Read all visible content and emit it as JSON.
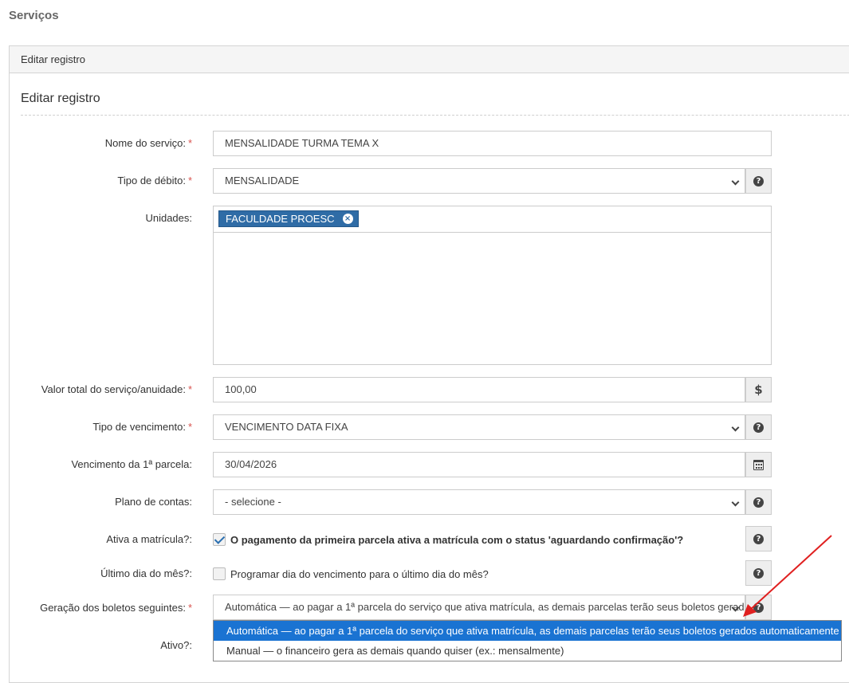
{
  "page": {
    "title": "Serviços"
  },
  "panel": {
    "heading": "Editar registro",
    "section_title": "Editar registro"
  },
  "form": {
    "nome": {
      "label": "Nome do serviço:",
      "value": "MENSALIDADE TURMA TEMA X"
    },
    "tipo_debito": {
      "label": "Tipo de débito:",
      "value": "MENSALIDADE"
    },
    "unidades": {
      "label": "Unidades:",
      "chips": [
        "FACULDADE PROESC"
      ]
    },
    "valor": {
      "label": "Valor total do serviço/anuidade:",
      "value": "100,00",
      "addon": "$"
    },
    "tipo_vencimento": {
      "label": "Tipo de vencimento:",
      "value": "VENCIMENTO DATA FIXA"
    },
    "vencimento_1": {
      "label": "Vencimento da 1ª parcela:",
      "value": "30/04/2026"
    },
    "plano_contas": {
      "label": "Plano de contas:",
      "value": "- selecione -"
    },
    "ativa_matricula": {
      "label": "Ativa a matrícula?:",
      "checked": true,
      "text": "O pagamento da primeira parcela ativa a matrícula com o status 'aguardando confirmação'?"
    },
    "ultimo_dia": {
      "label": "Último dia do mês?:",
      "checked": false,
      "text": "Programar dia do vencimento para o último dia do mês?"
    },
    "geracao": {
      "label": "Geração dos boletos seguintes:",
      "value": "Automática — ao pagar a 1ª parcela do serviço que ativa matrícula, as demais parcelas terão seus boletos gerados automaticamente",
      "options": [
        "Automática — ao pagar a 1ª parcela do serviço que ativa matrícula, as demais parcelas terão seus boletos gerados automaticamente",
        "Manual — o financeiro gera as demais quando quiser (ex.: mensalmente)"
      ]
    },
    "ativo": {
      "label": "Ativo?:"
    },
    "required_mark": "*"
  },
  "colors": {
    "chip": "#2f6ca6",
    "selected_option": "#1a73d2",
    "annotation_arrow": "#e02020"
  }
}
